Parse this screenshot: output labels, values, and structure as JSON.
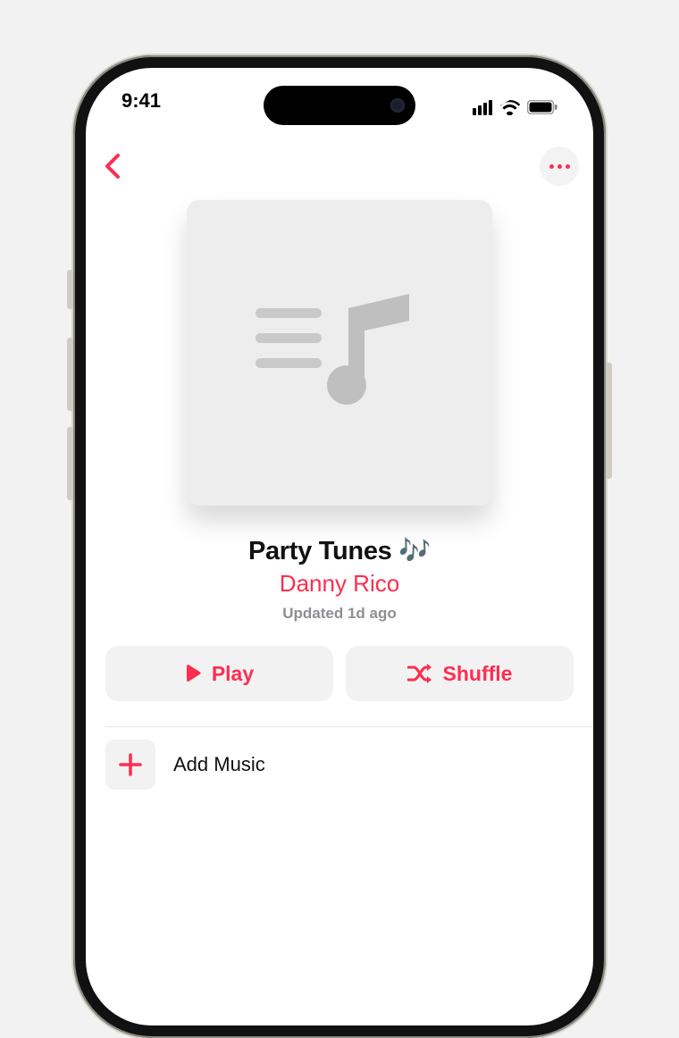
{
  "status": {
    "time": "9:41"
  },
  "playlist": {
    "title": "Party Tunes 🎶",
    "author": "Danny Rico",
    "updated": "Updated 1d ago"
  },
  "actions": {
    "play": "Play",
    "shuffle": "Shuffle",
    "add_music": "Add Music"
  }
}
